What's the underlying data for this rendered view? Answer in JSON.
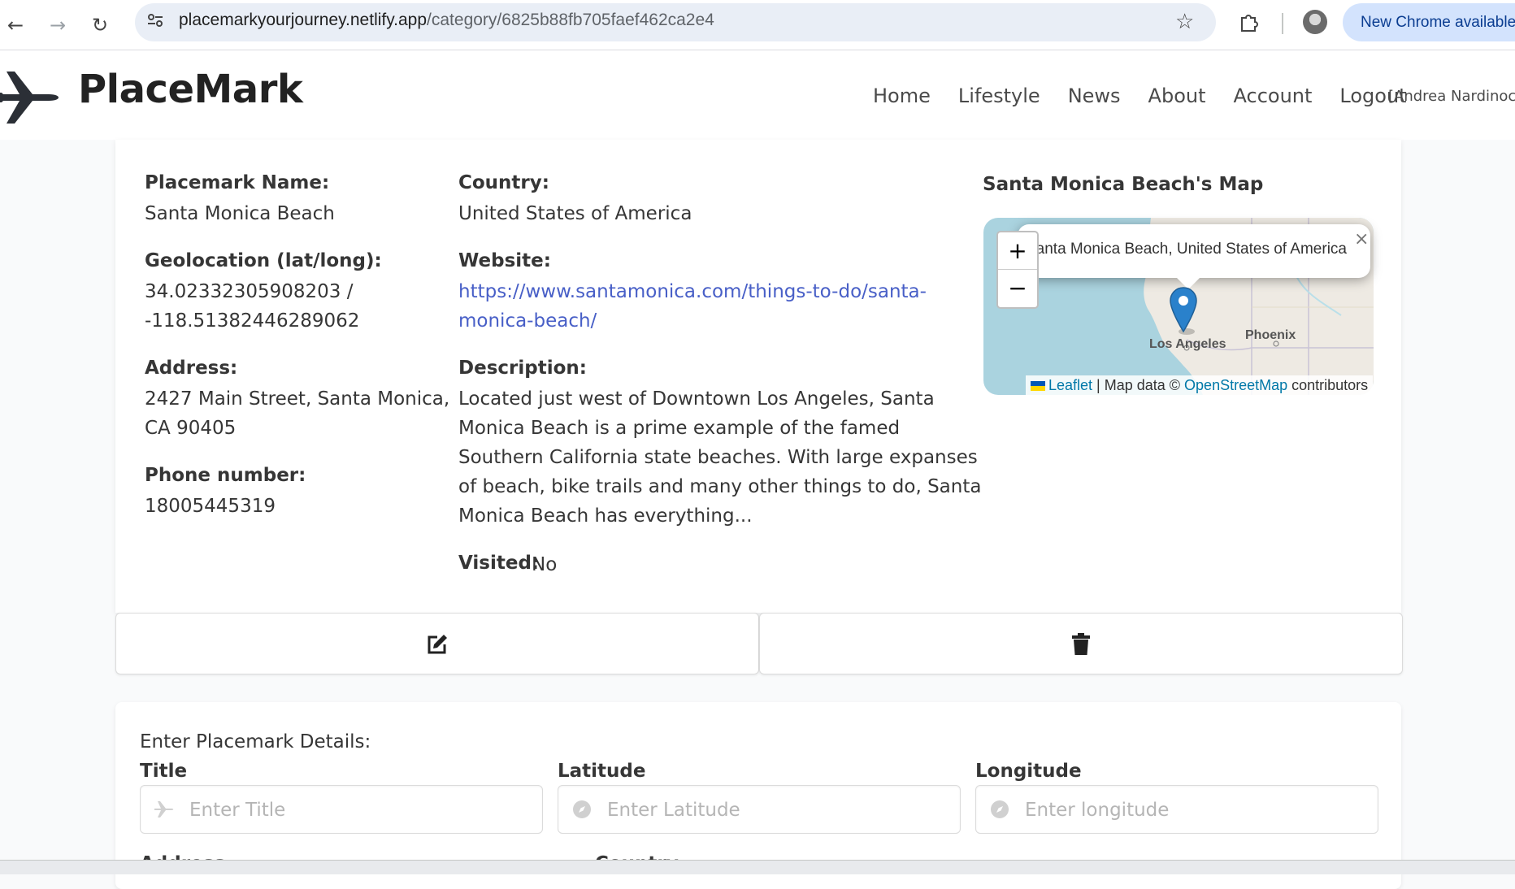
{
  "browser": {
    "url_domain": "placemarkyourjourney.netlify.app",
    "url_path": "/category/6825b88fb705faef462ca2e4",
    "update_label": "New Chrome available"
  },
  "header": {
    "brand": "PlaceMark",
    "menu": [
      "Home",
      "Lifestyle",
      "News",
      "About",
      "Account",
      "Logout"
    ],
    "user": "[Andrea Nardinocchi]"
  },
  "placemark": {
    "name_label": "Placemark Name:",
    "name": "Santa Monica Beach",
    "geo_label": "Geolocation (lat/long):",
    "lat": "34.02332305908203 /",
    "lng": "-118.51382446289062",
    "address_label": "Address:",
    "address_line1": "2427 Main Street, Santa Monica,",
    "address_line2": "CA 90405",
    "phone_label": "Phone number:",
    "phone": "18005445319",
    "country_label": "Country:",
    "country": "United States of America",
    "website_label": "Website:",
    "website_line1": "https://www.santamonica.com/things-to-do/santa-",
    "website_line2": "monica-beach/",
    "description_label": "Description:",
    "description_lines": [
      "Located just west of Downtown Los Angeles, Santa",
      "Monica Beach is a prime example of the famed",
      "Southern California state beaches. With large expanses",
      "of beach, bike trails and many other things to do, Santa",
      "Monica Beach has everything..."
    ],
    "visited_label": "Visited:",
    "visited": "No"
  },
  "map": {
    "title": "Santa Monica Beach's Map",
    "popup": "Santa Monica Beach, United States of America",
    "zoom_in": "+",
    "zoom_out": "−",
    "close": "×",
    "city_la": "Los Angeles",
    "city_phoenix": "Phoenix",
    "attr_leaflet": "Leaflet",
    "attr_mid": " | Map data © ",
    "attr_osm": "OpenStreetMap",
    "attr_end": " contributors"
  },
  "actions": {
    "edit_icon": "edit-icon",
    "delete_icon": "trash-icon"
  },
  "form": {
    "heading": "Enter Placemark Details:",
    "title_label": "Title",
    "title_placeholder": "Enter Title",
    "lat_label": "Latitude",
    "lat_placeholder": "Enter Latitude",
    "lng_label": "Longitude",
    "lng_placeholder": "Enter longitude",
    "next_label_1": "Address",
    "next_label_2": "Country"
  },
  "colors": {
    "link": "#485fc7",
    "map_water": "#aad3df",
    "marker": "#2a81cb"
  }
}
